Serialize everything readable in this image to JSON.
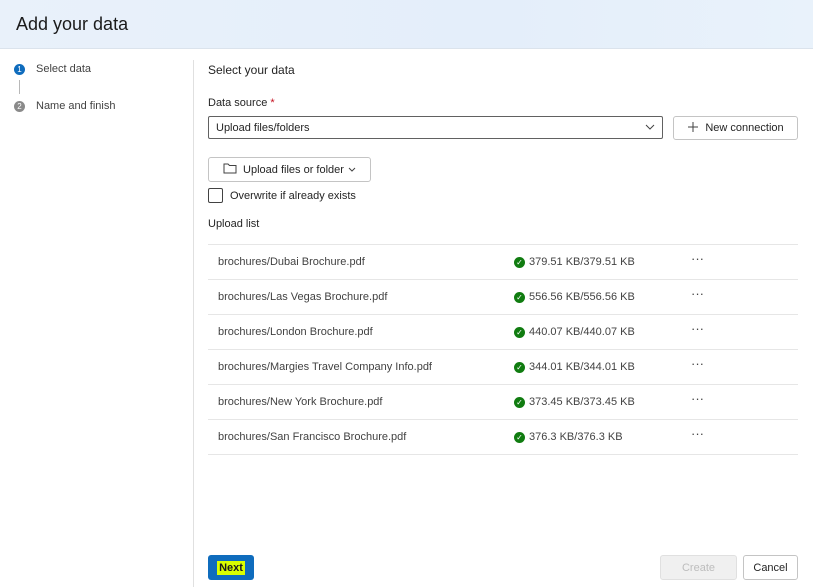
{
  "header": {
    "title": "Add your data"
  },
  "steps": [
    {
      "number": "1",
      "label": "Select data",
      "active": true
    },
    {
      "number": "2",
      "label": "Name and finish",
      "active": false
    }
  ],
  "main": {
    "section_title": "Select your data",
    "data_source_label": "Data source",
    "required_marker": "*",
    "data_source_value": "Upload files/folders",
    "new_connection_label": "New connection",
    "upload_button_label": "Upload files or folder",
    "overwrite_label": "Overwrite if already exists",
    "overwrite_checked": false,
    "upload_list_title": "Upload list",
    "upload_list": [
      {
        "name": "brochures/Dubai Brochure.pdf",
        "status": "379.51 KB/379.51 KB"
      },
      {
        "name": "brochures/Las Vegas Brochure.pdf",
        "status": "556.56 KB/556.56 KB"
      },
      {
        "name": "brochures/London Brochure.pdf",
        "status": "440.07 KB/440.07 KB"
      },
      {
        "name": "brochures/Margies Travel Company Info.pdf",
        "status": "344.01 KB/344.01 KB"
      },
      {
        "name": "brochures/New York Brochure.pdf",
        "status": "373.45 KB/373.45 KB"
      },
      {
        "name": "brochures/San Francisco Brochure.pdf",
        "status": "376.3 KB/376.3 KB"
      }
    ]
  },
  "footer": {
    "next_label": "Next",
    "create_label": "Create",
    "cancel_label": "Cancel"
  },
  "colors": {
    "accent": "#0f6cbd",
    "success": "#107c10",
    "highlight": "#d9ff00"
  }
}
